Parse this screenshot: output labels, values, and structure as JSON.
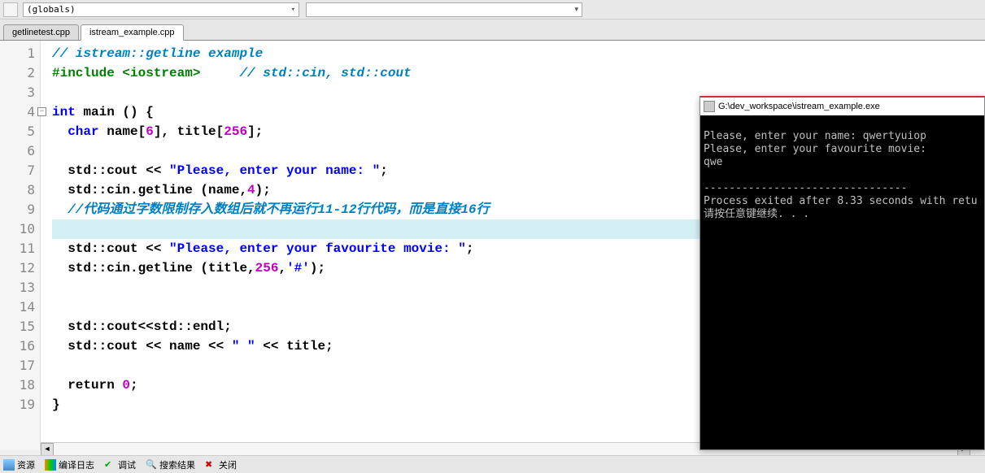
{
  "toolbar": {
    "globals_label": "(globals)"
  },
  "tabs": [
    {
      "label": "getlinetest.cpp",
      "active": false
    },
    {
      "label": "istream_example.cpp",
      "active": true
    }
  ],
  "gutter": [
    "1",
    "2",
    "3",
    "4",
    "5",
    "6",
    "7",
    "8",
    "9",
    "10",
    "11",
    "12",
    "13",
    "14",
    "15",
    "16",
    "17",
    "18",
    "19"
  ],
  "code": {
    "l1_comment": "// istream::getline example",
    "l2_include": "#include ",
    "l2_header": "<iostream>",
    "l2_comment": "     // std::cin, std::cout",
    "l4_int": "int",
    "l4_rest": " main () {",
    "l5_char": "char",
    "l5_a": " name[",
    "l5_n1": "6",
    "l5_b": "], title[",
    "l5_n2": "256",
    "l5_c": "];",
    "l7_a": "  std::cout << ",
    "l7_str": "\"Please, enter your name: \"",
    "l7_b": ";",
    "l8_a": "  std::cin.getline (name,",
    "l8_n": "4",
    "l8_b": ");",
    "l9_comment": "  //代码通过字数限制存入数组后就不再运行11-12行代码，而是直接16行",
    "l11_a": "  std::cout << ",
    "l11_str": "\"Please, enter your favourite movie: \"",
    "l11_b": ";",
    "l12_a": "  std::cin.getline (title,",
    "l12_n": "256",
    "l12_b": ",",
    "l12_ch": "'#'",
    "l12_c": ");",
    "l15": "  std::cout<<std::endl;",
    "l16_a": "  std::cout << name << ",
    "l16_str": "\" \"",
    "l16_b": " << title;",
    "l18_a": "  ",
    "l18_ret": "return",
    "l18_b": " ",
    "l18_n": "0",
    "l18_c": ";",
    "l19": "}"
  },
  "console": {
    "title": "G:\\dev_workspace\\istream_example.exe",
    "line1": "Please, enter your name: qwertyuiop",
    "line2": "Please, enter your favourite movie:",
    "line3": "qwe",
    "divider": "--------------------------------",
    "line5": "Process exited after 8.33 seconds with retu",
    "line6": "请按任意键继续. . ."
  },
  "bottom": {
    "resource": "资源",
    "compile_log": "编译日志",
    "debug": "调试",
    "search": "搜索结果",
    "close": "关闭"
  }
}
